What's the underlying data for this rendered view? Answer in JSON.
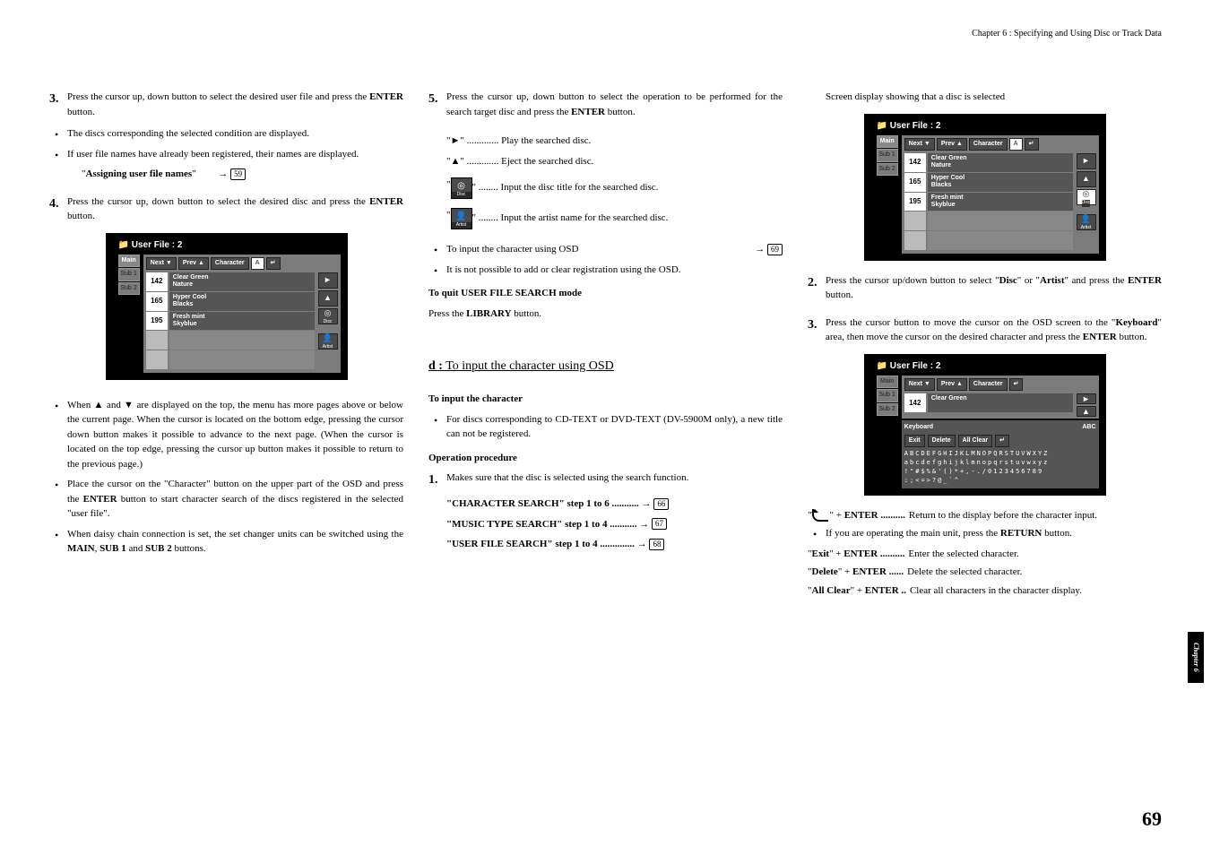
{
  "header": "Chapter 6 : Specifying and Using Disc or Track Data",
  "sideTab": "Chapter 6",
  "pageNumber": "69",
  "col1": {
    "step3": {
      "num": "3.",
      "text_a": "Press the cursor up, down button to select the desired user file and press the ",
      "text_b": "ENTER",
      "text_c": " button."
    },
    "b1": "The discs corresponding the selected condition are displayed.",
    "b2": "If user file names have already been registered, their names are displayed.",
    "assign_a": "\"",
    "assign_b": "Assigning user file names",
    "assign_c": "\"",
    "assign_page": "59",
    "step4": {
      "num": "4.",
      "text_a": "Press the cursor up, down button to select the desired disc and press the ",
      "text_b": "ENTER",
      "text_c": " button."
    },
    "bw1": "When ▲ and ▼ are displayed on the top, the menu has more pages above or below the current page. When the cursor is located on the bottom edge, pressing the cursor down button makes it possible to advance to the next page. (When the cursor is located on the top edge, pressing the cursor up button makes it possible to return to the previous page.)",
    "bw2_a": "Place the cursor on the \"Character\" button on the upper part of the OSD and press the ",
    "bw2_b": "ENTER",
    "bw2_c": " button to start character search of the discs registered in the selected \"user file\".",
    "bw3_a": "When daisy chain connection is set, the set changer units can be switched using the ",
    "bw3_b": "MAIN",
    "bw3_c": ", ",
    "bw3_d": "SUB 1",
    "bw3_e": " and ",
    "bw3_f": "SUB 2",
    "bw3_g": " buttons."
  },
  "col2": {
    "step5": {
      "num": "5.",
      "text_a": "Press the cursor up, down button to select the operation to be performed for the search target disc and press the ",
      "text_b": "ENTER",
      "text_c": " button."
    },
    "play": "\"►\" ............. Play the searched disc.",
    "eject": "\"▲\" ............. Eject the searched disc.",
    "disc_a": "\"",
    "disc_b": "\" ........ Input the disc title for the searched disc.",
    "disc_label": "Disc",
    "artist_a": "\"",
    "artist_b": "\" ........ Input the artist name for the searched disc.",
    "artist_label": "Artist",
    "b_input": "To input the character using OSD",
    "b_input_page": "69",
    "b_notposs": "It is not possible to add or clear registration using the OSD.",
    "quit_title": "To quit USER FILE SEARCH mode",
    "quit_text_a": "Press the ",
    "quit_text_b": "LIBRARY",
    "quit_text_c": " button.",
    "section_d_a": "d :",
    "section_d_b": " To input the character using OSD",
    "input_title": "To input the character",
    "input_b1": "For discs corresponding to CD-TEXT or DVD-TEXT (DV-5900M only),  a new title can not be registered.",
    "op_title": "Operation procedure",
    "op_step1": {
      "num": "1.",
      "text": "Makes sure that the disc is selected using the search function."
    },
    "char_search_a": "\"CHARACTER SEARCH\" step 1 to 6 ...........",
    "char_search_page": "66",
    "music_search_a": "\"MUSIC TYPE SEARCH\" step 1 to 4 ...........",
    "music_search_page": "67",
    "user_search_a": "\"USER FILE SEARCH\" step 1 to 4 ..............",
    "user_search_page": "68"
  },
  "col3": {
    "screen_caption": "Screen display showing that a disc is selected",
    "step2": {
      "num": "2.",
      "text_a": "Press the cursor up/down button to select \"",
      "text_b": "Disc",
      "text_c": "\" or \"",
      "text_d": "Artist",
      "text_e": "\" and press the ",
      "text_f": "ENTER",
      "text_g": " button."
    },
    "step3": {
      "num": "3.",
      "text_a": "Press the cursor button to move the cursor on the OSD screen to the \"",
      "text_b": "Keyboard",
      "text_c": "\" area, then move the cursor on the desired character and press the ",
      "text_d": "ENTER",
      "text_e": " button."
    },
    "return_a": "\"",
    "return_b": "\" + ",
    "return_c": "ENTER",
    "return_d": " ..........",
    "return_e": " Return to the display before the character input.",
    "if_main_a": "If you are operating the main unit, press the ",
    "if_main_b": "RETURN",
    "if_main_c": " button.",
    "exit_a": "\"",
    "exit_b": "Exit",
    "exit_c": "\" + ",
    "exit_d": "ENTER",
    "exit_e": " ..........",
    "exit_f": " Enter the selected character.",
    "del_a": "\"",
    "del_b": "Delete",
    "del_c": "\" + ",
    "del_d": "ENTER",
    "del_e": " ......",
    "del_f": " Delete the selected character.",
    "allc_a": "\"",
    "allc_b": "All Clear",
    "allc_c": "\" + ",
    "allc_d": "ENTER",
    "allc_e": " ..",
    "allc_f": " Clear all characters in the character display."
  },
  "osd": {
    "title": "User File : 2",
    "tabs": {
      "main": "Main",
      "sub1": "Sub 1",
      "sub2": "Sub 2"
    },
    "top": {
      "next": "Next ▼",
      "prev": "Prev ▲",
      "char": "Character",
      "enter": "↵"
    },
    "items": [
      {
        "num": "142",
        "l1": "Clear Green",
        "l2": "Nature"
      },
      {
        "num": "165",
        "l1": "Hyper Cool",
        "l2": "Blacks"
      },
      {
        "num": "195",
        "l1": "Fresh mint",
        "l2": "Skyblue"
      }
    ],
    "side": {
      "disc": "Disc",
      "artist": "Artist"
    }
  },
  "osd2": {
    "title": "User File : 2",
    "item": {
      "num": "142",
      "l1": "Clear Green"
    },
    "kbd": "Keyboard",
    "abc": "ABC",
    "buttons": {
      "exit": "Exit",
      "delete": "Delete",
      "allclear": "All Clear",
      "enter": "↵"
    },
    "chars1": "ABCDEFGHIJKLMNOPQRSTUVWXYZ",
    "chars2": "abcdefghijklmnopqrstuvwxyz",
    "chars3": "!\"#$%&'()*+,-./0123456789",
    "chars4": ":;<=>?@_`^"
  }
}
